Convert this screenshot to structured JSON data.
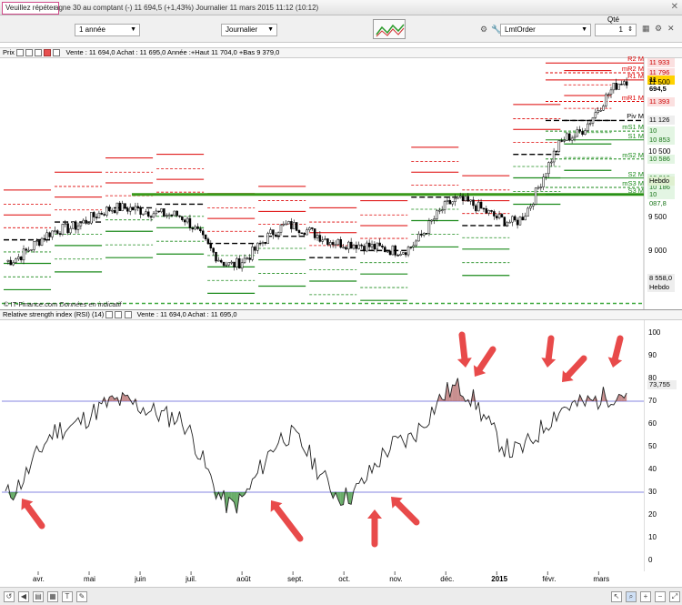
{
  "titlebar": {
    "tooltip": "Veuillez répéter",
    "instrument": "agne 30 au comptant (-)     11 694,5 (+1,43%)     Journalier  11 mars 2015 11:12 (10:12)"
  },
  "toolbar": {
    "period": "1 année",
    "interval": "Journalier",
    "order_type": "LmtOrder",
    "qty_label": "Qté",
    "qty_value": "1"
  },
  "price_panel": {
    "header_label": "Prix",
    "header_info": "Vente : 11 694,0 Achat : 11 695,0 Année :+Haut 11 704,0 +Bas 9 379,0",
    "copyright": "© IT-Finance.com",
    "copyright_note": "Données en indicatif",
    "levels": [
      {
        "label": "R2 M",
        "price": "11 933",
        "value": 11933,
        "color": "red"
      },
      {
        "label": "mR2 M",
        "price": "11 796",
        "value": 11796,
        "color": "red"
      },
      {
        "label": "R1 M",
        "price": "11 694,5",
        "value": 11694.5,
        "color": "red"
      },
      {
        "label": "mR1 M",
        "price": "11 393",
        "value": 11393,
        "color": "red"
      },
      {
        "label": "Piv M",
        "price": "11 126",
        "value": 11126,
        "color": "black"
      },
      {
        "label": "mS1 M",
        "price": "10 976,5",
        "value": 10976.5,
        "color": "green"
      },
      {
        "label": "S1 M",
        "price": "10 853",
        "value": 10853,
        "color": "green"
      },
      {
        "label": "mS2 M",
        "price": "10 586",
        "value": 10586,
        "color": "green"
      },
      {
        "label": "S2 M",
        "price": "10 319",
        "value": 10319,
        "color": "green"
      },
      {
        "label": "mS3 M",
        "price": "10 186",
        "value": 10186,
        "color": "green"
      },
      {
        "label": "S3 M",
        "price": "10 087,8",
        "value": 10087.8,
        "color": "green"
      }
    ],
    "weekly_high_label": "Hebdo",
    "weekly_low": {
      "price": "8 558,0",
      "label": "Hebdo"
    },
    "y_ticks": [
      "11 500",
      "10 500",
      "9 500",
      "9 000"
    ]
  },
  "rsi_panel": {
    "header_label": "Relative strength index (RSI) (14)",
    "header_info": "Vente : 11 694,0 Achat : 11 695,0",
    "current": "73,755",
    "y_ticks": [
      "100",
      "90",
      "80",
      "70",
      "60",
      "50",
      "40",
      "30",
      "20",
      "10",
      "0"
    ]
  },
  "x_axis": {
    "months": [
      "avr.",
      "mai",
      "juin",
      "juil.",
      "août",
      "sept.",
      "oct.",
      "nov.",
      "déc.",
      "2015",
      "févr.",
      "mars"
    ]
  },
  "colors": {
    "resistance": "#dd0000",
    "support": "#1a8a1a",
    "pivot": "#000000",
    "arrow": "#e84a4a",
    "rsi_band": "#5b5bd6",
    "highlight": "#ffd200"
  },
  "chart_data": [
    {
      "type": "candlestick",
      "title": "Prix",
      "x": [
        "avr.",
        "mai",
        "juin",
        "juil.",
        "août",
        "sept.",
        "oct.",
        "nov.",
        "déc.",
        "2015",
        "févr.",
        "mars"
      ],
      "close": [
        9150,
        9600,
        9900,
        9800,
        9100,
        9650,
        9400,
        9300,
        10000,
        9700,
        10900,
        11694.5
      ],
      "ylim": [
        8500,
        12000
      ]
    },
    {
      "type": "line",
      "title": "Relative strength index (RSI) (14)",
      "x": [
        "avr.",
        "mai",
        "juin",
        "juil.",
        "août",
        "sept.",
        "oct.",
        "nov.",
        "déc.",
        "2015",
        "févr.",
        "mars"
      ],
      "values": [
        29,
        58,
        70,
        63,
        24,
        55,
        28,
        52,
        76,
        48,
        68,
        73.755
      ],
      "bands": [
        30,
        70
      ],
      "ylim": [
        0,
        100
      ]
    }
  ]
}
